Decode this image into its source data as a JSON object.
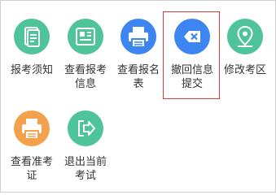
{
  "tiles": [
    {
      "line1": "报考须知",
      "line2": "",
      "color": "#4fc49a",
      "icon": "document-icon"
    },
    {
      "line1": "查看报考",
      "line2": "信息",
      "color": "#4fc49a",
      "icon": "newspaper-icon"
    },
    {
      "line1": "查看报名",
      "line2": "表",
      "color": "#3d86f2",
      "icon": "printer-icon"
    },
    {
      "line1": "撤回信息",
      "line2": "提交",
      "color": "#3d86f2",
      "icon": "backspace-icon"
    },
    {
      "line1": "修改考区",
      "line2": "",
      "color": "#4fc49a",
      "icon": "location-pin-icon"
    },
    {
      "line1": "查看准考",
      "line2": "证",
      "color": "#f5a04d",
      "icon": "printer-icon"
    },
    {
      "line1": "退出当前",
      "line2": "考试",
      "color": "#4fc49a",
      "icon": "exit-icon"
    }
  ]
}
